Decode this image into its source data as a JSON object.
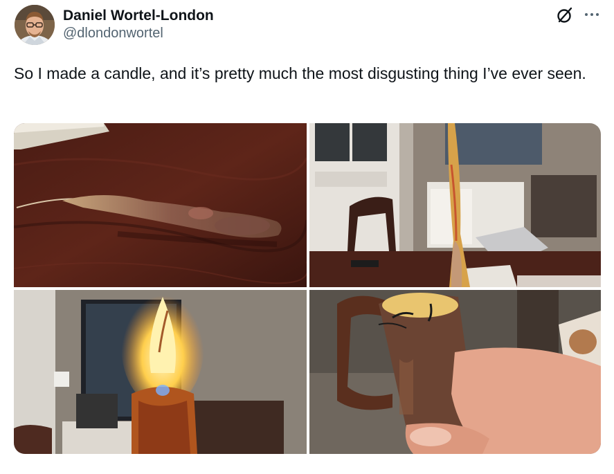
{
  "author": {
    "display_name": "Daniel Wortel-London",
    "handle": "@dlondonwortel",
    "avatar_icon": "user-avatar"
  },
  "header_actions": {
    "grok_icon": "grok-icon",
    "more_icon": "more-horizontal-icon"
  },
  "tweet": {
    "text": "So I made a candle, and it’s pretty much the most disgusting thing I’ve ever seen."
  },
  "media": {
    "photo_count": 4
  }
}
